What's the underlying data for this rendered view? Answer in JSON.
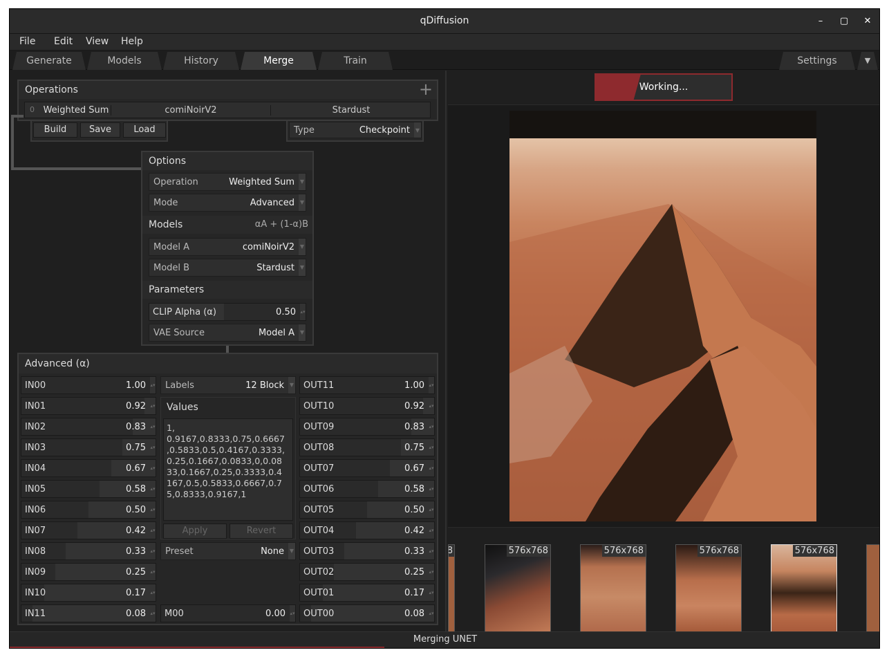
{
  "window": {
    "title": "qDiffusion",
    "min": "–",
    "max": "▢",
    "close": "✕"
  },
  "menu": [
    "File",
    "Edit",
    "View",
    "Help"
  ],
  "tabs": [
    "Generate",
    "Models",
    "History",
    "Merge",
    "Train"
  ],
  "settings_tab": "Settings",
  "tab_dropdown": "▼",
  "operations": {
    "title": "Operations",
    "add": "+",
    "row": {
      "index": "0",
      "op": "Weighted Sum",
      "model_a": "comiNoirV2",
      "model_b": "Stardust"
    },
    "buttons": [
      "Build",
      "Save",
      "Load"
    ],
    "type_label": "Type",
    "type_value": "Checkpoint"
  },
  "options": {
    "title": "Options",
    "operation_label": "Operation",
    "operation_value": "Weighted Sum",
    "mode_label": "Mode",
    "mode_value": "Advanced",
    "models_title": "Models",
    "formula": "αA + (1-α)B",
    "model_a_label": "Model A",
    "model_a_value": "comiNoirV2",
    "model_b_label": "Model B",
    "model_b_value": "Stardust",
    "params_title": "Parameters",
    "clip_label": "CLIP Alpha (α)",
    "clip_value": "0.50",
    "vae_label": "VAE Source",
    "vae_value": "Model A"
  },
  "advanced": {
    "title": "Advanced (α)",
    "in": [
      {
        "l": "IN00",
        "v": "1.00"
      },
      {
        "l": "IN01",
        "v": "0.92"
      },
      {
        "l": "IN02",
        "v": "0.83"
      },
      {
        "l": "IN03",
        "v": "0.75"
      },
      {
        "l": "IN04",
        "v": "0.67"
      },
      {
        "l": "IN05",
        "v": "0.58"
      },
      {
        "l": "IN06",
        "v": "0.50"
      },
      {
        "l": "IN07",
        "v": "0.42"
      },
      {
        "l": "IN08",
        "v": "0.33"
      },
      {
        "l": "IN09",
        "v": "0.25"
      },
      {
        "l": "IN10",
        "v": "0.17"
      },
      {
        "l": "IN11",
        "v": "0.08"
      }
    ],
    "out": [
      {
        "l": "OUT11",
        "v": "1.00"
      },
      {
        "l": "OUT10",
        "v": "0.92"
      },
      {
        "l": "OUT09",
        "v": "0.83"
      },
      {
        "l": "OUT08",
        "v": "0.75"
      },
      {
        "l": "OUT07",
        "v": "0.67"
      },
      {
        "l": "OUT06",
        "v": "0.58"
      },
      {
        "l": "OUT05",
        "v": "0.50"
      },
      {
        "l": "OUT04",
        "v": "0.42"
      },
      {
        "l": "OUT03",
        "v": "0.33"
      },
      {
        "l": "OUT02",
        "v": "0.25"
      },
      {
        "l": "OUT01",
        "v": "0.17"
      },
      {
        "l": "OUT00",
        "v": "0.08"
      }
    ],
    "labels_label": "Labels",
    "labels_value": "12 Block",
    "values_title": "Values",
    "values_text": "1,\n0.9167,0.8333,0.75,0.6667\n,0.5833,0.5,0.4167,0.3333,\n0.25,0.1667,0.0833,0,0.08\n33,0.1667,0.25,0.3333,0.4\n167,0.5,0.5833,0.6667,0.7\n5,0.8333,0.9167,1",
    "apply": "Apply",
    "revert": "Revert",
    "preset_label": "Preset",
    "preset_value": "None",
    "m00_label": "M00",
    "m00_value": "0.00"
  },
  "working": {
    "label": "Working...",
    "progress": 0.33
  },
  "thumbs": [
    "576x768",
    "576x768",
    "576x768",
    "576x768"
  ],
  "thumb_partial": "8",
  "status": {
    "text": "Merging UNET",
    "progress": 0.43
  },
  "colors": {
    "accent": "#8e2a2e",
    "bg": "#1f1f1f"
  }
}
